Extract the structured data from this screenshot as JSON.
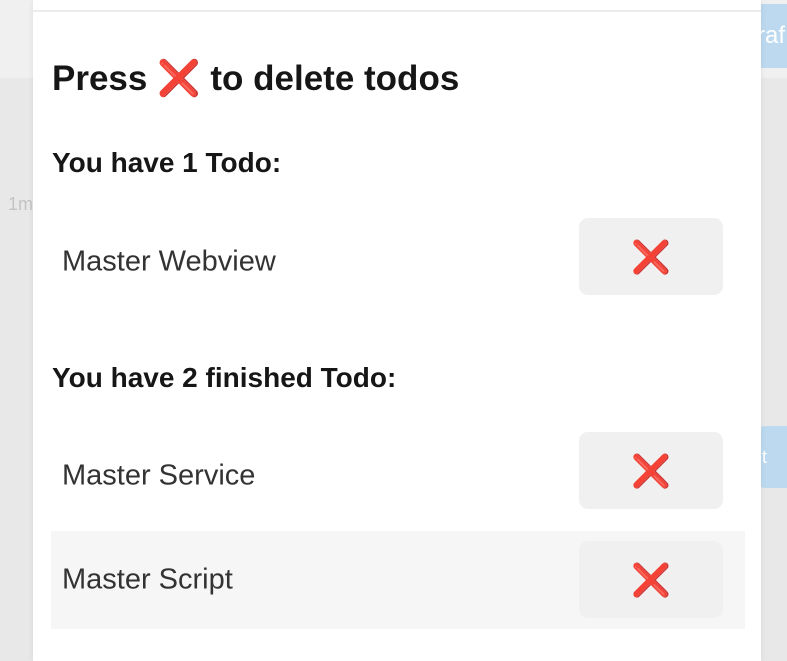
{
  "background": {
    "stamp": "1m",
    "pill_top": "raf",
    "pill_bottom": "t"
  },
  "header": {
    "title": "Press ❌ to delete todos"
  },
  "open_section": {
    "heading": "You have 1 Todo:",
    "items": [
      {
        "label": "Master Webview",
        "delete_icon": "❌"
      }
    ]
  },
  "finished_section": {
    "heading": "You have 2 finished Todo:",
    "items": [
      {
        "label": "Master Service",
        "delete_icon": "❌"
      },
      {
        "label": "Master Script",
        "delete_icon": "❌"
      }
    ]
  },
  "colors": {
    "delete_icon": "#e02d2d",
    "button_bg": "#f0f0f0",
    "row_highlight": "#f6f6f6"
  },
  "icons": {
    "delete": "cross-mark-icon"
  }
}
